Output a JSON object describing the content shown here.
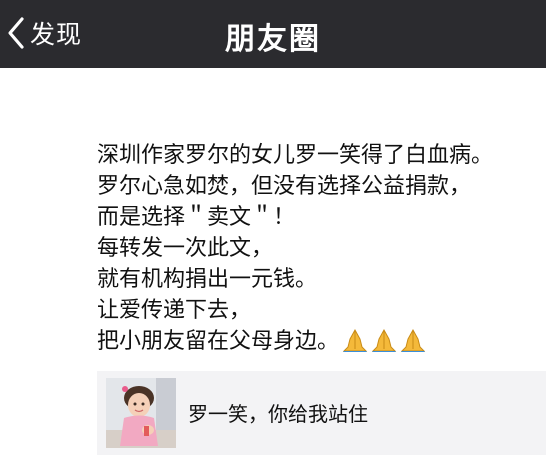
{
  "navbar": {
    "back_label": "发现",
    "title": "朋友圈"
  },
  "post": {
    "lines": [
      "深圳作家罗尔的女儿罗一笑得了白血病。",
      "罗尔心急如焚，但没有选择公益捐款，",
      "而是选择＂卖文＂！",
      "每转发一次此文，",
      "就有机构捐出一元钱。",
      "让爱传递下去，",
      "把小朋友留在父母身边。"
    ],
    "emoji": "🙏🙏🙏"
  },
  "link_card": {
    "title": "罗一笑，你给我站住"
  },
  "colors": {
    "navbar_bg": "#2b2b2f",
    "card_bg": "#f3f3f5"
  }
}
